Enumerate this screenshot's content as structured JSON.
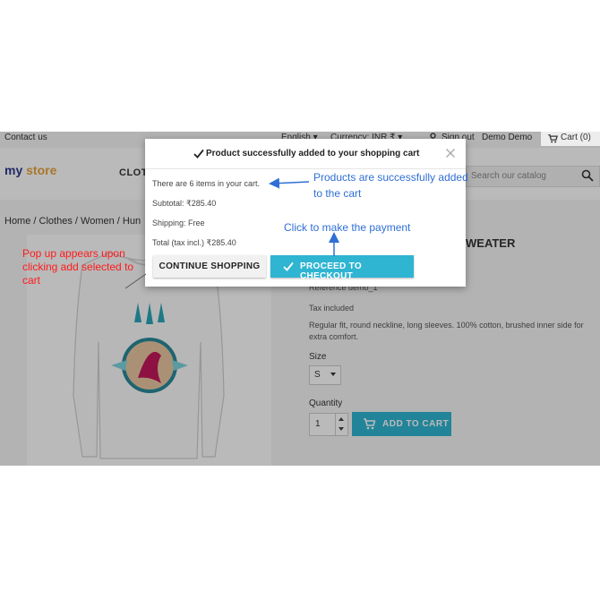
{
  "topbar": {
    "contact": "Contact us",
    "language": "English",
    "currency": "Currency: INR ₹",
    "sign_out": "Sign out",
    "user": "Demo Demo",
    "cart": "Cart (0)"
  },
  "header": {
    "logo_my": "my",
    "logo_store": " store",
    "nav_item": "CLOTH",
    "search_placeholder": "Search our catalog"
  },
  "breadcrumb": {
    "home": "Home",
    "clothes": "Clothes",
    "women": "Women",
    "partial": "Hun"
  },
  "product": {
    "title_partial": "WEATER",
    "reference": "Reference demo_1",
    "tax": "Tax included",
    "description": "Regular fit, round neckline, long sleeves. 100% cotton, brushed inner side for extra comfort.",
    "size_label": "Size",
    "size_value": "S",
    "quantity_label": "Quantity",
    "quantity_value": "1",
    "add_to_cart": "ADD TO CART"
  },
  "modal": {
    "title": "Product successfully added to your shopping cart",
    "items_text": "There are 6 items in your cart.",
    "subtotal_label": "Subtotal:",
    "subtotal_value": "₹285.40",
    "shipping_label": "Shipping:",
    "shipping_value": "Free",
    "total_label": "Total (tax incl.)",
    "total_value": "₹285.40",
    "continue_button": "CONTINUE SHOPPING",
    "checkout_button": "PROCEED TO CHECKOUT"
  },
  "annotations": {
    "products_added_line1": "Products are successfully added",
    "products_added_line2": "to the cart",
    "payment": "Click to make the payment",
    "popup_line1": "Pop up appears upon",
    "popup_line2": "clicking add selected to",
    "popup_line3": "cart"
  },
  "colors": {
    "accent": "#2fb5d2",
    "annotation_blue": "#2f6fd6",
    "annotation_red": "#ff1a1a"
  }
}
